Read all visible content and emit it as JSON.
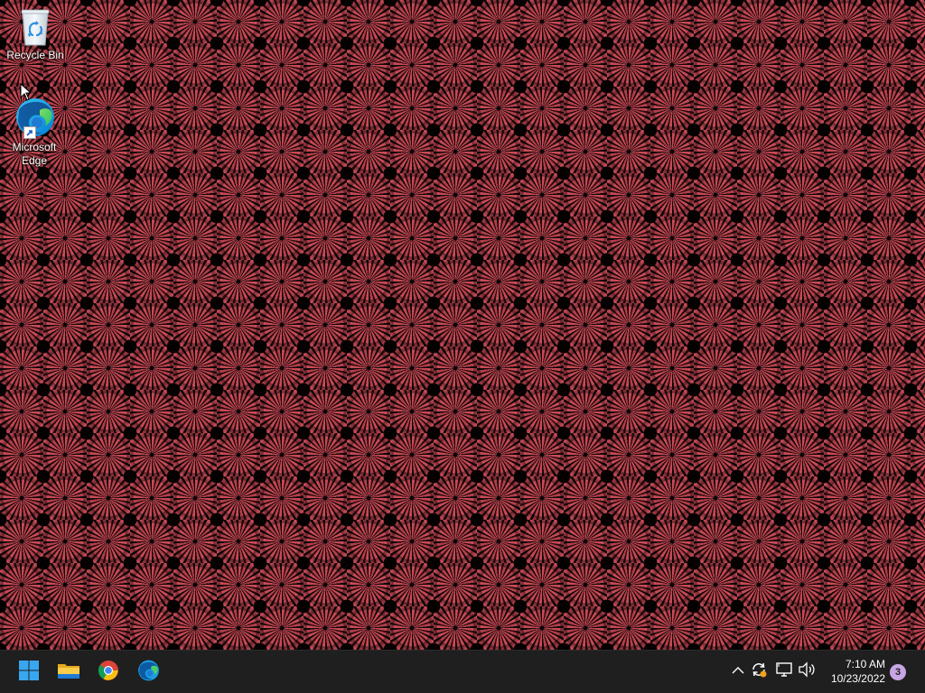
{
  "desktop": {
    "icons": [
      {
        "label": "Recycle Bin",
        "icon": "recycle-bin-icon"
      },
      {
        "label": "Microsoft\nEdge",
        "icon": "edge-icon",
        "shortcut": true
      }
    ],
    "wallpaper_colors": {
      "primary": "#c74a55",
      "background": "#050304"
    }
  },
  "taskbar": {
    "apps": [
      {
        "name": "Start",
        "icon": "windows-start-icon"
      },
      {
        "name": "File Explorer",
        "icon": "folder-icon"
      },
      {
        "name": "Google Chrome",
        "icon": "chrome-icon"
      },
      {
        "name": "Microsoft Edge",
        "icon": "edge-icon"
      }
    ],
    "tray": {
      "icons": [
        "chevron-up-icon",
        "sync-icon",
        "network-icon",
        "volume-icon"
      ]
    },
    "clock": {
      "time": "7:10 AM",
      "date": "10/23/2022"
    },
    "notifications": {
      "count": "3"
    }
  }
}
